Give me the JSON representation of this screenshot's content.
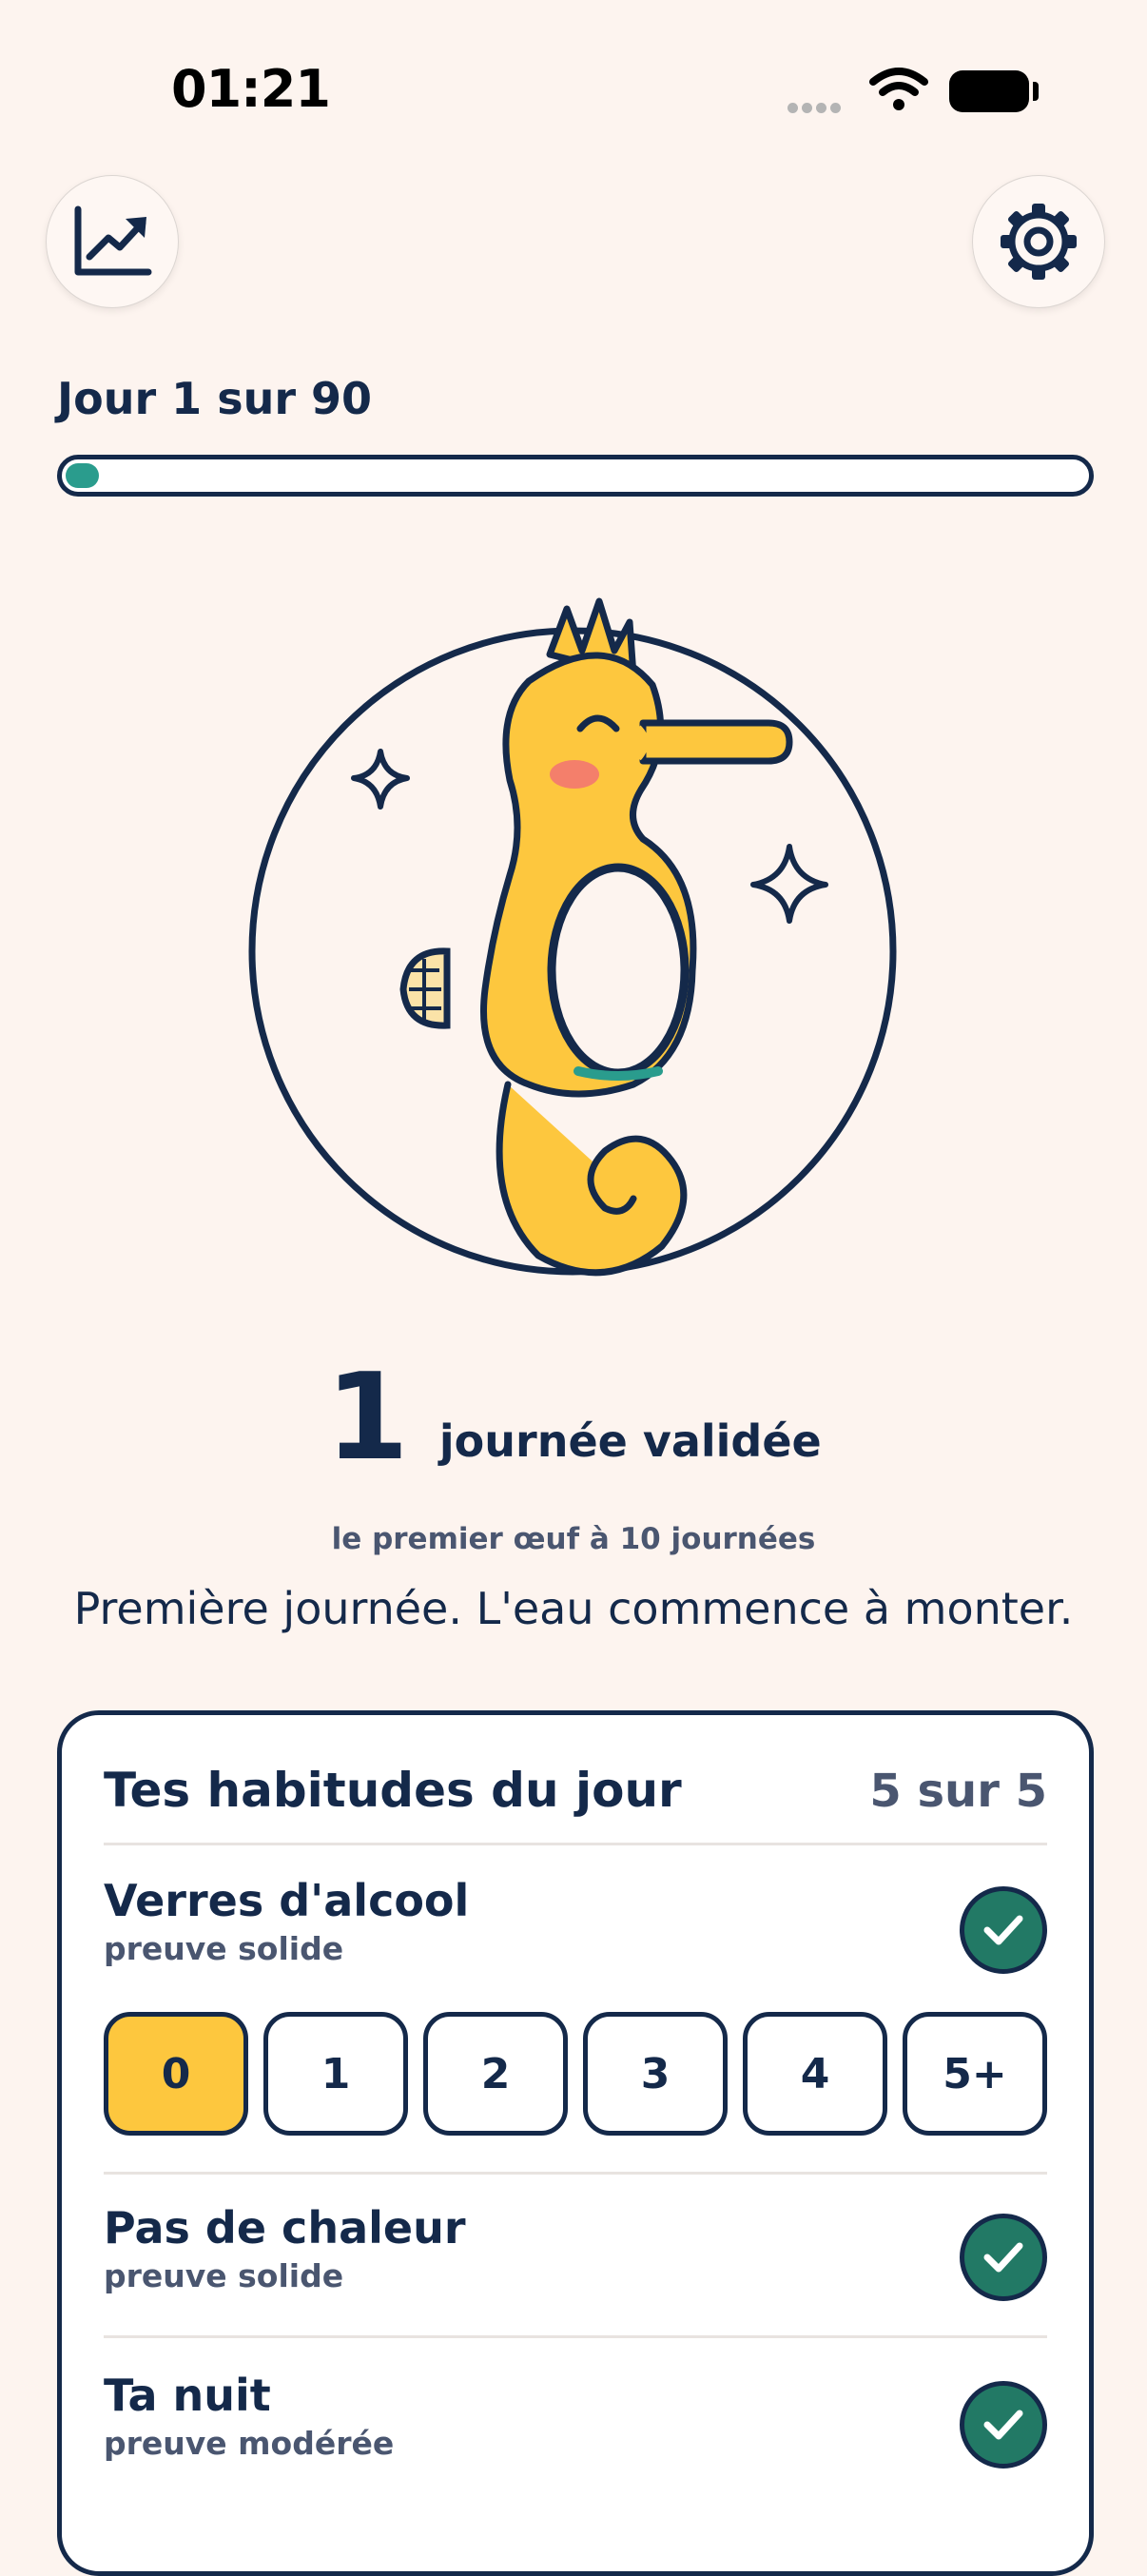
{
  "status_bar": {
    "time": "01:21"
  },
  "header": {
    "stats_icon": "trending-up-chart-icon",
    "settings_icon": "gear-icon"
  },
  "progress": {
    "label": "Jour 1 sur 90",
    "current_day": 1,
    "total_days": 90,
    "fraction": 0.011
  },
  "hero": {
    "illustration": "seahorse-mascot",
    "accent_colors": {
      "body": "#fdc73e",
      "outline": "#14294a",
      "cheek": "#f47f6b",
      "water": "#2a9c8d"
    }
  },
  "stats": {
    "count": "1",
    "count_label": "journée validée",
    "next_milestone": "le premier œuf à 10 journées",
    "message": "Première journée. L'eau commence à monter."
  },
  "habits": {
    "title": "Tes habitudes du jour",
    "count": "5 sur 5",
    "items": [
      {
        "name": "Verres d'alcool",
        "sub": "preuve solide",
        "done": true
      },
      {
        "name": "Pas de chaleur",
        "sub": "preuve solide",
        "done": true
      },
      {
        "name": "Ta nuit",
        "sub": "preuve modérée",
        "done": true
      }
    ],
    "alcohol_options": [
      "0",
      "1",
      "2",
      "3",
      "4",
      "5+"
    ],
    "alcohol_selected": "0"
  },
  "colors": {
    "background": "#fdf4ef",
    "ink": "#14294a",
    "accent_yellow": "#fdc73e",
    "check_green": "#227965",
    "progress_teal": "#2a9c8d"
  }
}
